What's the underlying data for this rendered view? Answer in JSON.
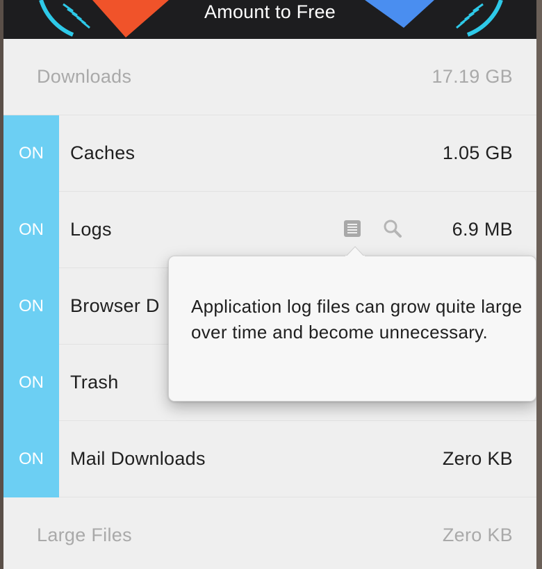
{
  "header": {
    "title": "Amount to Free"
  },
  "colors": {
    "toggle_on": "#6ccff3",
    "gauge_left": "#f0532a",
    "gauge_right": "#4a8ef0",
    "gauge_ring": "#2ec9e8",
    "header_bg": "#1d1d1f"
  },
  "rows": [
    {
      "label": "Downloads",
      "size": "17.19 GB",
      "toggle": ""
    },
    {
      "label": "Caches",
      "size": "1.05 GB",
      "toggle": "ON"
    },
    {
      "label": "Logs",
      "size": "6.9 MB",
      "toggle": "ON",
      "icons": [
        "document-list-icon",
        "magnify-icon"
      ]
    },
    {
      "label": "Browser D",
      "size": "",
      "toggle": "ON"
    },
    {
      "label": "Trash",
      "size": "",
      "toggle": "ON"
    },
    {
      "label": "Mail Downloads",
      "size": "Zero KB",
      "toggle": "ON"
    },
    {
      "label": "Large Files",
      "size": "Zero KB",
      "toggle": ""
    }
  ],
  "tooltip": {
    "text": "Application log files can grow quite large over time and become unnecessary."
  }
}
